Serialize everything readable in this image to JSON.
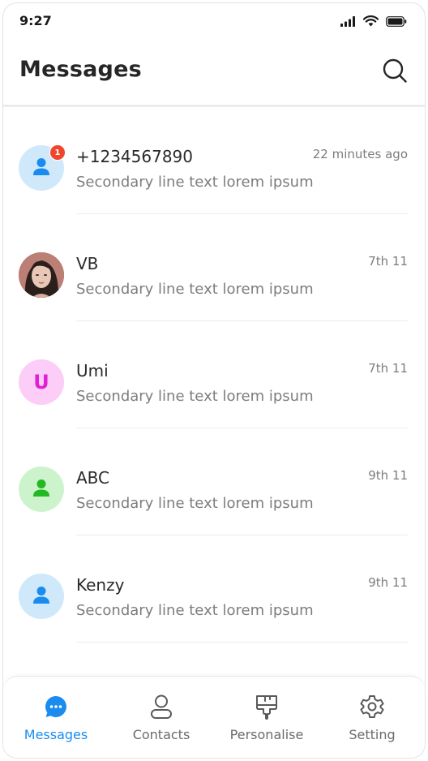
{
  "status_bar": {
    "time": "9:27",
    "icons": [
      "signal-icon",
      "wifi-icon",
      "battery-icon"
    ]
  },
  "header": {
    "title": "Messages",
    "search_icon": "search-icon"
  },
  "messages": [
    {
      "name": "+1234567890",
      "preview": "Secondary line text lorem ipsum",
      "time": "22 minutes ago",
      "avatar_type": "person-icon",
      "avatar_bg": "#cfe9fb",
      "avatar_fg": "#1a8cf0",
      "badge": "1"
    },
    {
      "name": "VB",
      "preview": "Secondary line text lorem ipsum",
      "time": "7th 11",
      "avatar_type": "photo"
    },
    {
      "name": "Umi",
      "preview": "Secondary line text lorem ipsum",
      "time": "7th 11",
      "avatar_type": "letter",
      "avatar_letter": "U",
      "avatar_bg": "#fbcdf7",
      "avatar_fg": "#e01fd6"
    },
    {
      "name": "ABC",
      "preview": "Secondary line text lorem ipsum",
      "time": "9th 11",
      "avatar_type": "person-icon",
      "avatar_bg": "#cdf3cd",
      "avatar_fg": "#22b922"
    },
    {
      "name": "Kenzy",
      "preview": "Secondary line text lorem ipsum",
      "time": "9th 11",
      "avatar_type": "person-icon",
      "avatar_bg": "#cfe9fb",
      "avatar_fg": "#1a8cf0"
    }
  ],
  "bottom_nav": {
    "items": [
      {
        "label": "Messages",
        "icon": "chat-bubble-icon",
        "active": true
      },
      {
        "label": "Contacts",
        "icon": "user-icon",
        "active": false
      },
      {
        "label": "Personalise",
        "icon": "paint-roller-icon",
        "active": false
      },
      {
        "label": "Setting",
        "icon": "gear-icon",
        "active": false
      }
    ]
  },
  "colors": {
    "accent": "#1a8cf0",
    "badge": "#f0452a",
    "text_primary": "#2a2a2a",
    "text_secondary": "#7d7d7d"
  }
}
